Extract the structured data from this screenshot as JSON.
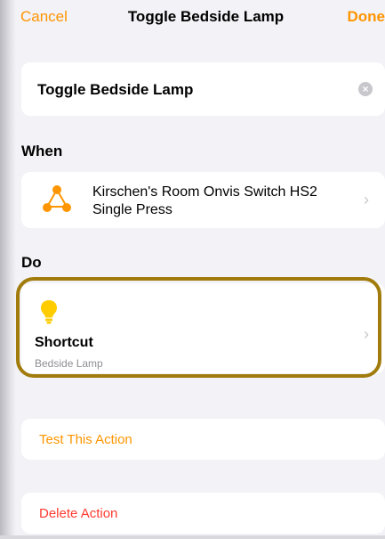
{
  "nav": {
    "cancel_label": "Cancel",
    "title": "Toggle Bedside Lamp",
    "done_label": "Done"
  },
  "automation_name": "Toggle Bedside Lamp",
  "sections": {
    "when_header": "When",
    "do_header": "Do"
  },
  "trigger": {
    "icon": "accessory-trigger-icon",
    "line1": "Kirschen's Room Onvis Switch HS2",
    "line2": "Single Press"
  },
  "action": {
    "icon": "lightbulb-icon",
    "title": "Shortcut",
    "subtitle": "Bedside Lamp"
  },
  "test_label": "Test This Action",
  "delete_label": "Delete Action",
  "colors": {
    "accent": "#ff9500",
    "destructive": "#ff3b30",
    "highlight_border": "#a17c0c",
    "background": "#f2f2f7"
  }
}
